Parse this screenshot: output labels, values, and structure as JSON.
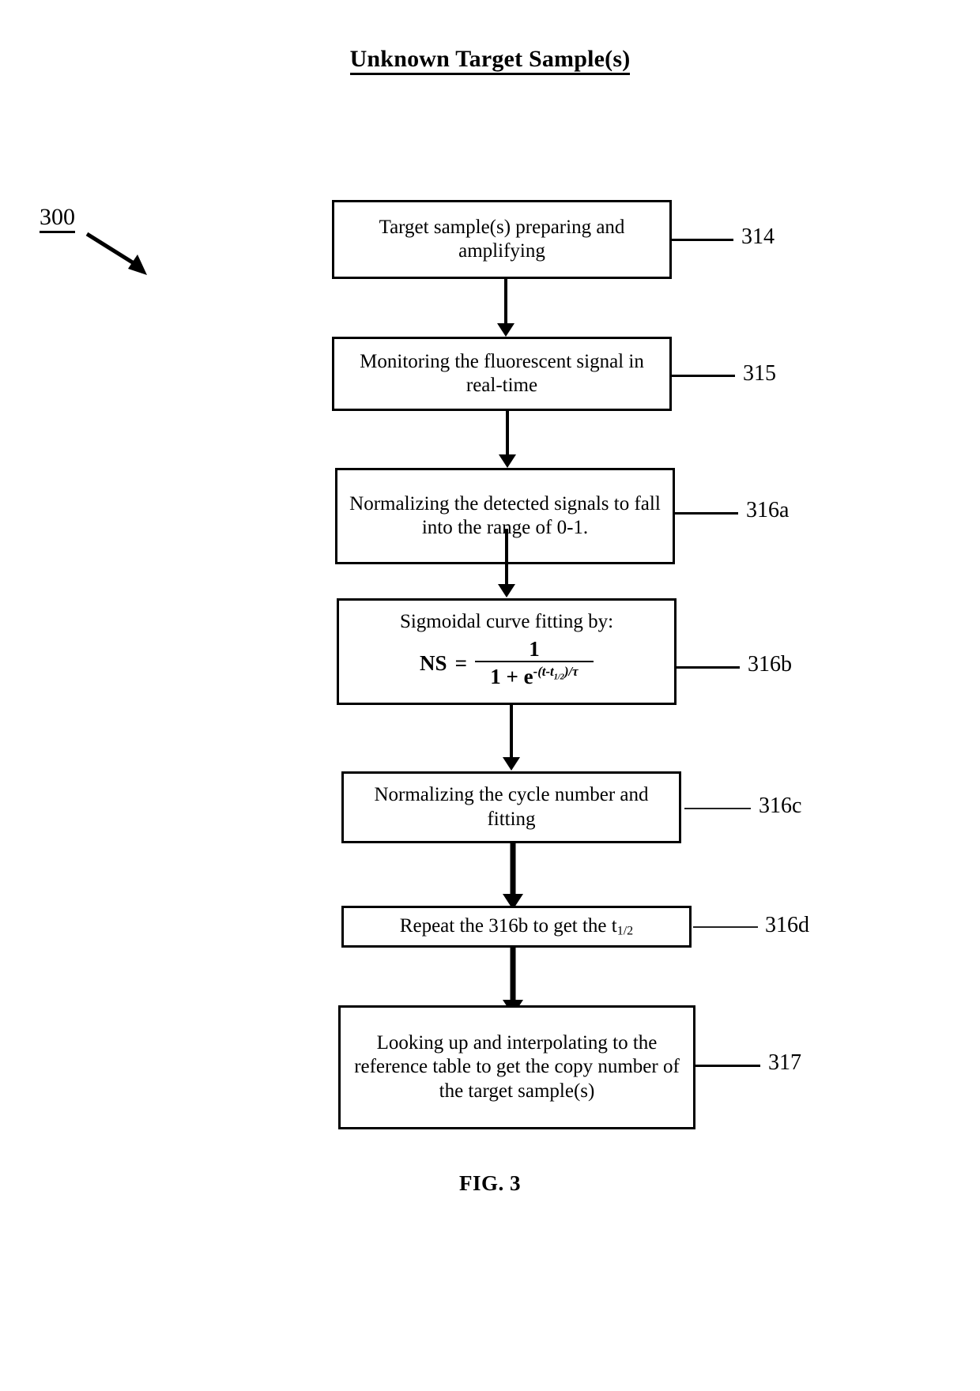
{
  "figure": {
    "title": "Unknown Target Sample(s)",
    "caption": "FIG. 3",
    "diagram_ref": "300"
  },
  "nodes": [
    {
      "id": "314",
      "ref": "314",
      "text": "Target sample(s) preparing and amplifying"
    },
    {
      "id": "315",
      "ref": "315",
      "text": "Monitoring the fluorescent signal in real-time"
    },
    {
      "id": "316a",
      "ref": "316a",
      "text": "Normalizing the detected signals to fall into the range of 0-1."
    },
    {
      "id": "316b",
      "ref": "316b",
      "text": "Sigmoidal curve fitting by:",
      "formula": {
        "lhs": "NS",
        "equals": "=",
        "numerator": "1",
        "denominator_base": "1 + e",
        "exponent": "-(t-t",
        "exponent_sub": "1/2",
        "exponent_tail": ")/",
        "exponent_tau": "τ"
      }
    },
    {
      "id": "316c",
      "ref": "316c",
      "text": "Normalizing the cycle number and fitting"
    },
    {
      "id": "316d",
      "ref": "316d",
      "text_prefix": "Repeat the 316b to get the t",
      "text_sub": "1/2"
    },
    {
      "id": "317",
      "ref": "317",
      "text": "Looking up and interpolating to the reference table to get the copy number of the target sample(s)"
    }
  ],
  "colors": {
    "ink": "#000000",
    "paper": "#ffffff"
  }
}
